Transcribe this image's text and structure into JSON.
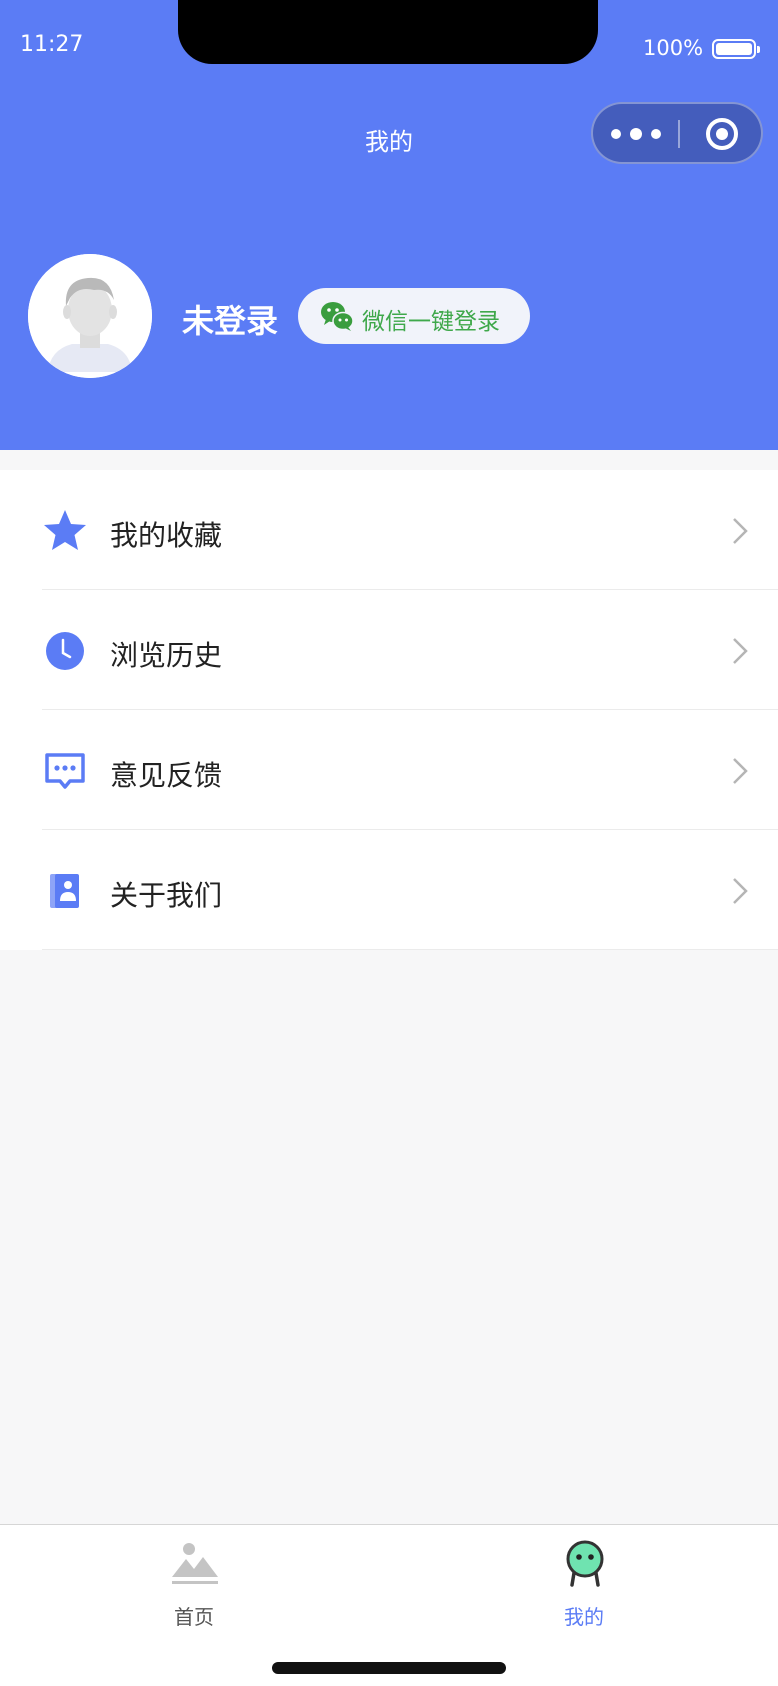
{
  "status_bar": {
    "time": "11:27",
    "battery": "100%"
  },
  "nav": {
    "title": "我的"
  },
  "profile": {
    "name": "未登录",
    "login_button": "微信一键登录"
  },
  "menu": [
    {
      "label": "我的收藏",
      "icon": "star-icon"
    },
    {
      "label": "浏览历史",
      "icon": "clock-icon"
    },
    {
      "label": "意见反馈",
      "icon": "feedback-icon"
    },
    {
      "label": "关于我们",
      "icon": "about-icon"
    }
  ],
  "tabbar": [
    {
      "label": "首页",
      "icon": "landscape-icon",
      "active": false
    },
    {
      "label": "我的",
      "icon": "robot-face-icon",
      "active": true
    }
  ],
  "colors": {
    "brand": "#5b7cf5",
    "wechat_green": "#3fa84b",
    "active_tab": "#5b7cf5",
    "inactive_tab": "#555555"
  }
}
